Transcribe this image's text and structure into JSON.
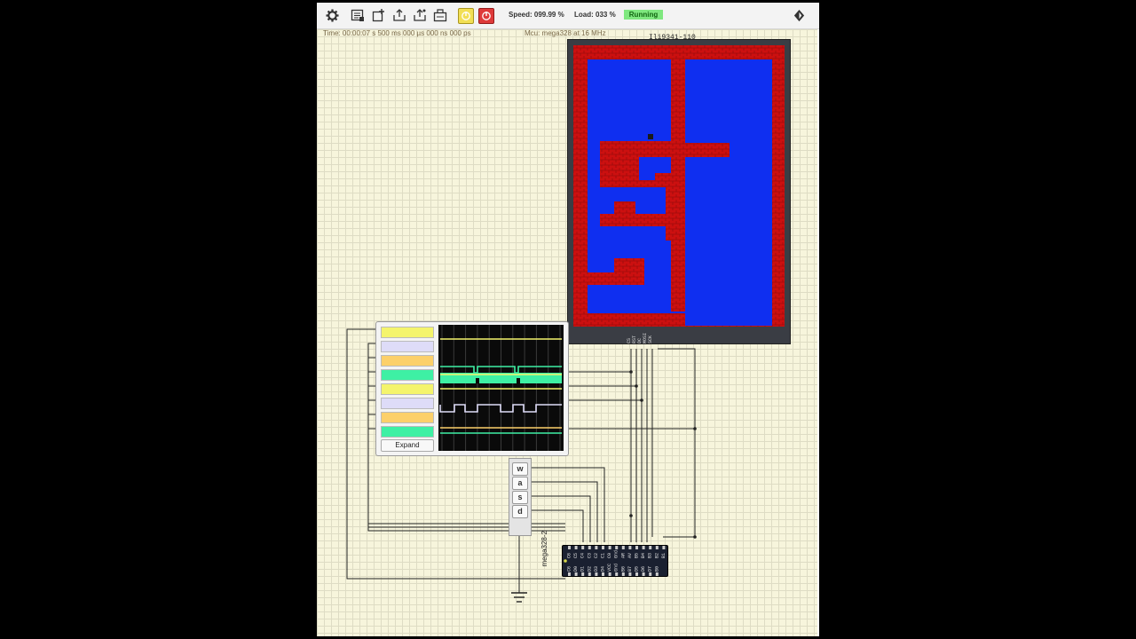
{
  "toolbar": {
    "speed": "Speed: 099.99 %",
    "load": "Load: 033 %",
    "state": "Running",
    "icons": [
      "gear-icon",
      "open-icon",
      "new-icon",
      "upload-icon",
      "export-icon",
      "library-icon",
      "pause-icon",
      "stop-icon",
      "extensions-icon"
    ]
  },
  "info": {
    "time": "Time: 00:00:07 s  500 ms  000 µs  000 ns  000 ps",
    "mcu": "Mcu: mega328 at 16 MHz"
  },
  "display": {
    "label": "Ili9341-110",
    "pins": [
      "CS",
      "RST",
      "DC",
      "MOSI",
      "SCK"
    ],
    "wall_color": "#cc1010",
    "floor_color": "#0f2ff0"
  },
  "analyzer": {
    "expand_label": "Expand",
    "channel_colors": [
      "#f4f46c",
      "#dedcf8",
      "#fcd06a",
      "#3ef0a4",
      "#f4f46c",
      "#dedcf8",
      "#fcd06a",
      "#3ef0a4"
    ]
  },
  "keypad": {
    "keys": [
      "w",
      "a",
      "s",
      "d"
    ]
  },
  "mcu": {
    "label": "mega328-2",
    "top_pins": [
      "C6",
      "C5",
      "C4",
      "C3",
      "C2",
      "C1",
      "C0",
      "Gnd",
      "AR",
      "AV",
      "B5",
      "B4",
      "B3",
      "B2",
      "B1"
    ],
    "bottom_pins": [
      "C6",
      "D0",
      "D1",
      "D2",
      "D3",
      "D4",
      "VCC",
      "Gnd",
      "B6",
      "B7",
      "D5",
      "D6",
      "D7",
      "B0"
    ]
  }
}
